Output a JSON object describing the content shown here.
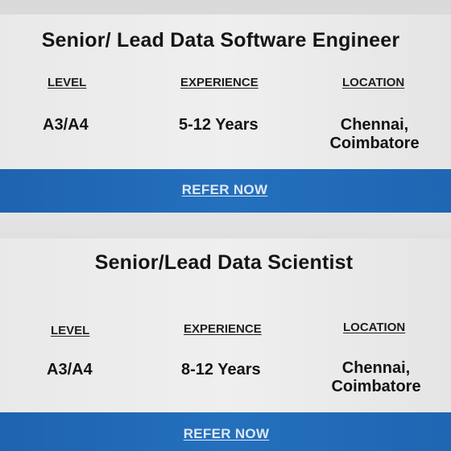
{
  "jobs": [
    {
      "title": "Senior/ Lead Data Software Engineer",
      "level_label": "LEVEL",
      "experience_label": "EXPERIENCE",
      "location_label": "LOCATION",
      "level": "A3/A4",
      "experience": "5-12 Years",
      "location_line1": "Chennai,",
      "location_line2": "Coimbatore",
      "refer_label": "REFER NOW"
    },
    {
      "title": "Senior/Lead Data Scientist",
      "level_label": "LEVEL",
      "experience_label": "EXPERIENCE",
      "location_label": "LOCATION",
      "level": "A3/A4",
      "experience": "8-12 Years",
      "location_line1": "Chennai,",
      "location_line2": "Coimbatore",
      "refer_label": "REFER NOW"
    }
  ],
  "colors": {
    "refer_bar": "#2470bd",
    "card_background": "#ececec",
    "text": "#151515"
  }
}
